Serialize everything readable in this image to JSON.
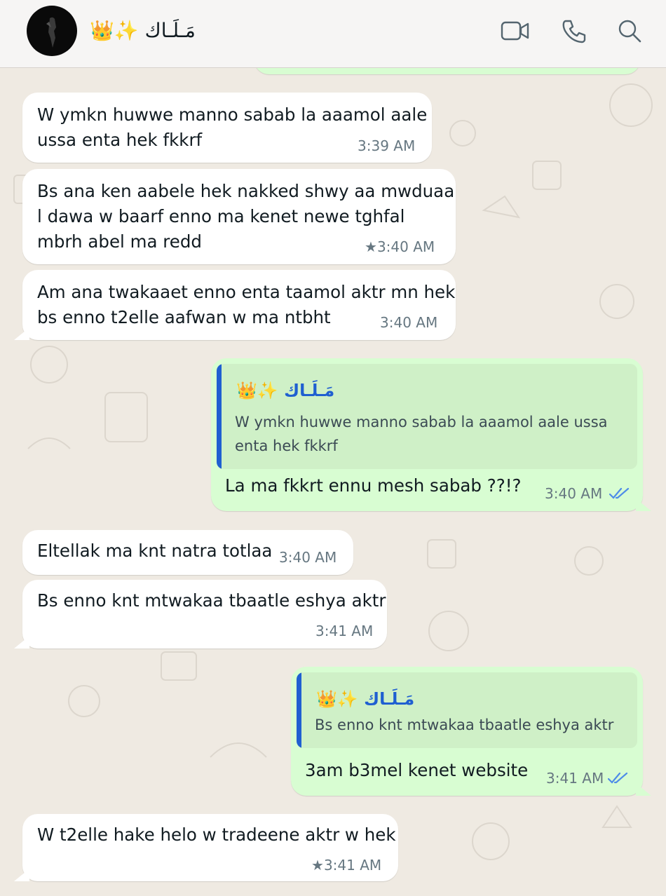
{
  "header": {
    "contact_name": "👑✨ مَـلَـاك",
    "icons": [
      "video-camera-icon",
      "phone-icon",
      "search-icon"
    ]
  },
  "messages": [
    {
      "direction": "incoming",
      "lines": [
        "W ymkn huwwe manno sabab la aaamol aale",
        "ussa enta hek fkkrf"
      ],
      "time": "3:39 AM",
      "starred": false
    },
    {
      "direction": "incoming",
      "lines": [
        "Bs ana ken aabele hek nakked shwy aa mwduaa",
        "l dawa w baarf enno ma kenet newe tghfal",
        "mbrh abel ma redd"
      ],
      "time": "3:40 AM",
      "starred": true
    },
    {
      "direction": "incoming",
      "lines": [
        "Am ana twakaaet enno enta taamol aktr mn hek",
        "bs enno t2elle aafwan w ma ntbht"
      ],
      "time": "3:40 AM",
      "starred": false
    },
    {
      "direction": "outgoing",
      "quote": {
        "name": "👑✨ مَـلَـاك",
        "lines": [
          "W ymkn huwwe manno sabab la aaamol aale ussa",
          "enta hek fkkrf"
        ]
      },
      "text": "La ma fkkrt ennu mesh sabab ??!?",
      "time": "3:40 AM",
      "status": "read"
    },
    {
      "direction": "incoming",
      "lines": [
        "Eltellak ma knt natra totlaa"
      ],
      "time": "3:40 AM",
      "starred": false
    },
    {
      "direction": "incoming",
      "lines": [
        "Bs enno knt mtwakaa tbaatle eshya aktr"
      ],
      "time": "3:41 AM",
      "starred": false
    },
    {
      "direction": "outgoing",
      "quote": {
        "name": "👑✨ مَـلَـاك",
        "lines": [
          "Bs enno knt mtwakaa tbaatle eshya aktr"
        ]
      },
      "text": "3am b3mel kenet website",
      "time": "3:41 AM",
      "status": "read"
    },
    {
      "direction": "incoming",
      "lines": [
        "W t2elle hake helo w tradeene aktr w hek"
      ],
      "time": "3:41 AM",
      "starred": true
    }
  ],
  "colors": {
    "incoming_bubble": "#ffffff",
    "outgoing_bubble": "#d8fdd2",
    "quote_accent": "#1f5fd1",
    "read_ticks": "#4e8ce8",
    "chat_background": "#efeae2"
  }
}
